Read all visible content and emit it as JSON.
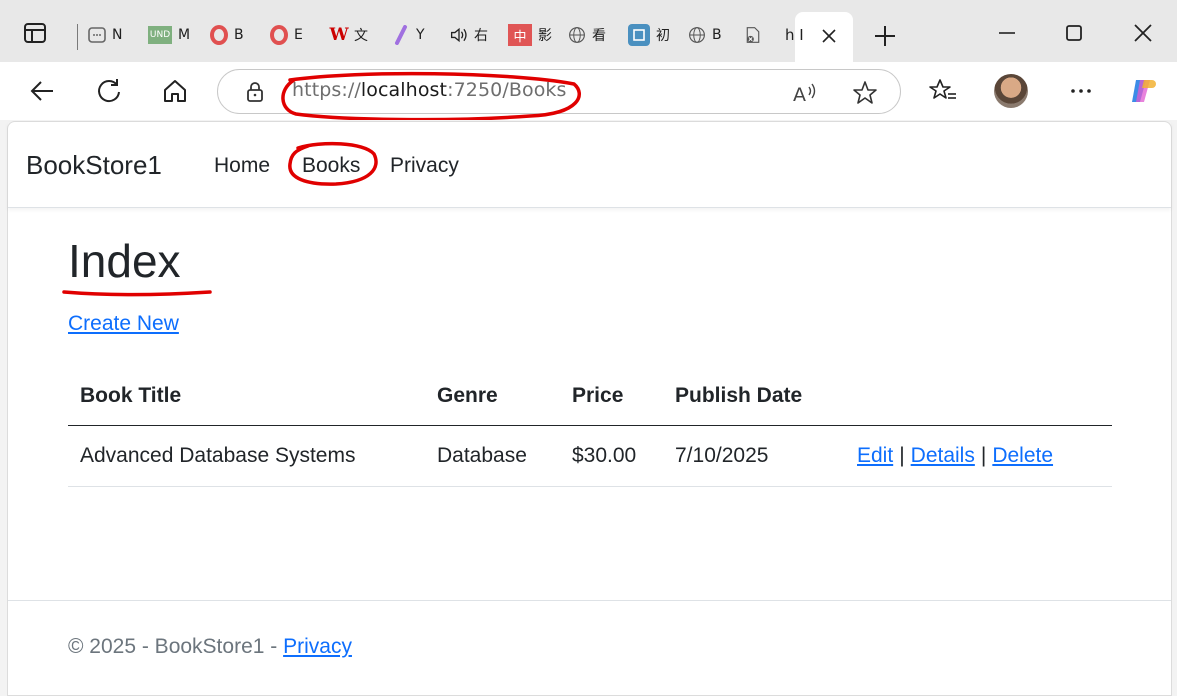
{
  "browser": {
    "tabs": [
      {
        "label": "N",
        "icon": "calendar-icon"
      },
      {
        "label": "M",
        "icon": "und-icon"
      },
      {
        "label": "B",
        "icon": "opera-icon"
      },
      {
        "label": "E",
        "icon": "opera-icon"
      },
      {
        "label": "文",
        "icon": "w-icon"
      },
      {
        "label": "Y",
        "icon": "slash-icon"
      },
      {
        "label": "右",
        "icon": "speaker-icon"
      },
      {
        "label": "影",
        "icon": "chinese-icon"
      },
      {
        "label": "看",
        "icon": "globe-icon"
      },
      {
        "label": "初",
        "icon": "app-icon"
      },
      {
        "label": "B",
        "icon": "globe-icon"
      },
      {
        "label": "h I",
        "icon": "blocked-page-icon"
      }
    ],
    "address": {
      "scheme": "https://",
      "host": "localhost",
      "rest": ":7250/Books"
    },
    "accent_color": "#e00000"
  },
  "site": {
    "brand": "BookStore1",
    "nav": {
      "home": "Home",
      "books": "Books",
      "privacy": "Privacy"
    }
  },
  "page": {
    "title": "Index",
    "create_link": "Create New",
    "table": {
      "headers": {
        "title": "Book Title",
        "genre": "Genre",
        "price": "Price",
        "date": "Publish Date"
      },
      "rows": [
        {
          "title": "Advanced Database Systems",
          "genre": "Database",
          "price": "$30.00",
          "date": "7/10/2025",
          "edit": "Edit",
          "details": "Details",
          "delete": "Delete"
        }
      ]
    }
  },
  "footer": {
    "text": "© 2025 - BookStore1 - ",
    "link": "Privacy"
  },
  "colors": {
    "link": "#0d6efd",
    "text": "#212529",
    "muted": "#6c757d",
    "annotation": "#e00000"
  }
}
